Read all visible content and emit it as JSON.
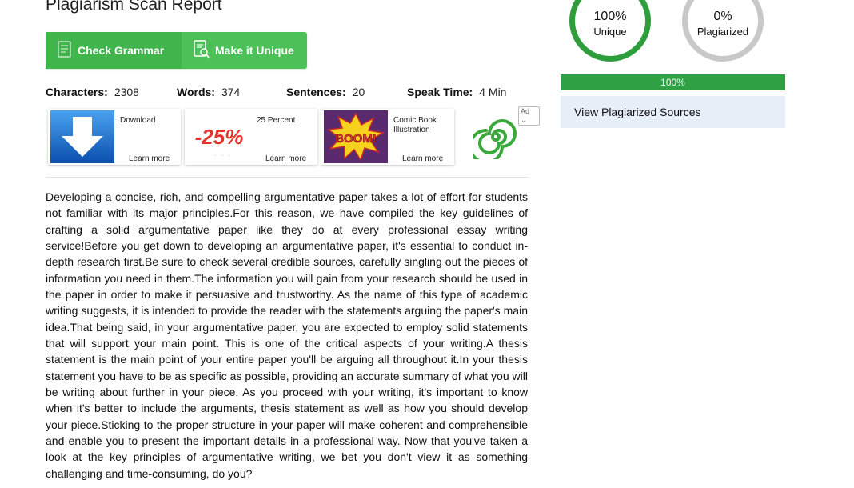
{
  "page_title": "Plagiarism Scan Report",
  "buttons": {
    "check_grammar": "Check Grammar",
    "make_unique": "Make it Unique"
  },
  "stats": {
    "characters_label": "Characters:",
    "characters_value": "2308",
    "words_label": "Words:",
    "words_value": "374",
    "sentences_label": "Sentences:",
    "sentences_value": "20",
    "speak_time_label": "Speak Time:",
    "speak_time_value": "4 Min"
  },
  "ads": {
    "flag": "Ad",
    "items": [
      {
        "name": "Download",
        "cta": "Learn more",
        "icon": "download-arrow-image"
      },
      {
        "name": "25 Percent",
        "cta": "Learn more",
        "icon": "discount-25-image",
        "image_text": "-25%"
      },
      {
        "name": "Comic Book Illustration",
        "cta": "Learn more",
        "icon": "comic-boom-image",
        "image_text": "BOOM!"
      }
    ],
    "logo_icon": "green-spiral-logo"
  },
  "article": "Developing a concise, rich, and compelling argumentative paper takes a lot of effort for students not familiar with its major principles.For this reason, we have compiled the key guidelines of crafting a solid argumentative paper like they do at every professional essay writing service!Before you get down to developing an argumentative paper, it's essential to conduct in-depth research first.Be sure to check several credible sources, carefully singling out the pieces of information you need in them.The information you will gain from your research should be used in the paper in order to make it persuasive and trustworthy. As the name of this type of academic writing suggests, it is intended to provide the reader with the statements arguing the paper's main idea.That being said, in your argumentative paper, you are expected to employ solid statements that will support your main point. This is one of the critical aspects of your writing.A thesis statement is the main point of your entire paper you'll be arguing all throughout it.In your thesis statement you have to be as specific as possible, providing an accurate summary of what you will be writing about further in your piece. As you proceed with your writing, it's important to know when it's better to include the arguments, thesis statement as well as how you should develop your piece.Sticking to the proper structure in your paper will make coherent and comprehensible and enable you to present the important details in a professional way. Now that you've taken a look at the key principles of argumentative writing, we bet you don't view it as something challenging and time-consuming, do you?",
  "results": {
    "unique_pct": "100%",
    "unique_label": "Unique",
    "plag_pct": "0%",
    "plag_label": "Plagiarized",
    "progress_value": 1.0,
    "progress_text": "100%",
    "view_sources": "View Plagiarized Sources"
  },
  "colors": {
    "button_green": "#4cc158",
    "unique_ring": "#2e9e3c",
    "plag_ring": "#c8c8c8",
    "progress": "#2fa043",
    "sources_bg": "#e6eef7"
  }
}
